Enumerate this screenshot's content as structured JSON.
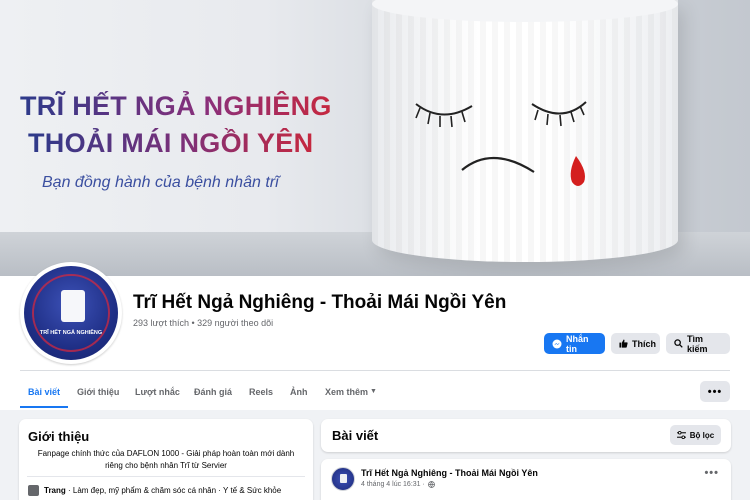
{
  "cover": {
    "headline_line1": "TRĨ HẾT NGẢ NGHIÊNG",
    "headline_line2": "THOẢI MÁI NGỒI YÊN",
    "tagline": "Bạn đồng hành của bệnh nhân trĩ"
  },
  "avatar": {
    "text": "TRĨ HẾT NGẢ NGHIÊNG"
  },
  "page": {
    "name": "Trĩ Hết Ngả Nghiêng - Thoải Mái Ngồi Yên",
    "stats": "293 lượt thích • 329 người theo dõi"
  },
  "actions": {
    "message_label": "Nhắn tin",
    "like_label": "Thích",
    "search_label": "Tìm kiếm"
  },
  "tabs": [
    {
      "label": "Bài viết",
      "active": true
    },
    {
      "label": "Giới thiệu"
    },
    {
      "label": "Lượt nhắc"
    },
    {
      "label": "Đánh giá"
    },
    {
      "label": "Reels"
    },
    {
      "label": "Ảnh"
    },
    {
      "label": "Xem thêm"
    }
  ],
  "intro": {
    "title": "Giới thiệu",
    "description": "Fanpage chính thức của DAFLON 1000 - Giải pháp hoàn toàn mới dành riêng cho bệnh nhân Trĩ từ Servier",
    "category_label": "Trang",
    "category_text": " · Làm đẹp, mỹ phẩm & chăm sóc cá nhân · Y tế & Sức khỏe"
  },
  "posts": {
    "title": "Bài viết",
    "filter_label": "Bộ lọc",
    "first_post": {
      "author": "Trĩ Hết Ngả Nghiêng - Thoải Mái Ngồi Yên",
      "time": "4 tháng 4 lúc 16:31 ·"
    }
  },
  "colors": {
    "accent": "#1877f2",
    "background": "#f0f2f5",
    "brand_navy": "#2c3a8a",
    "brand_red": "#c6283f"
  }
}
